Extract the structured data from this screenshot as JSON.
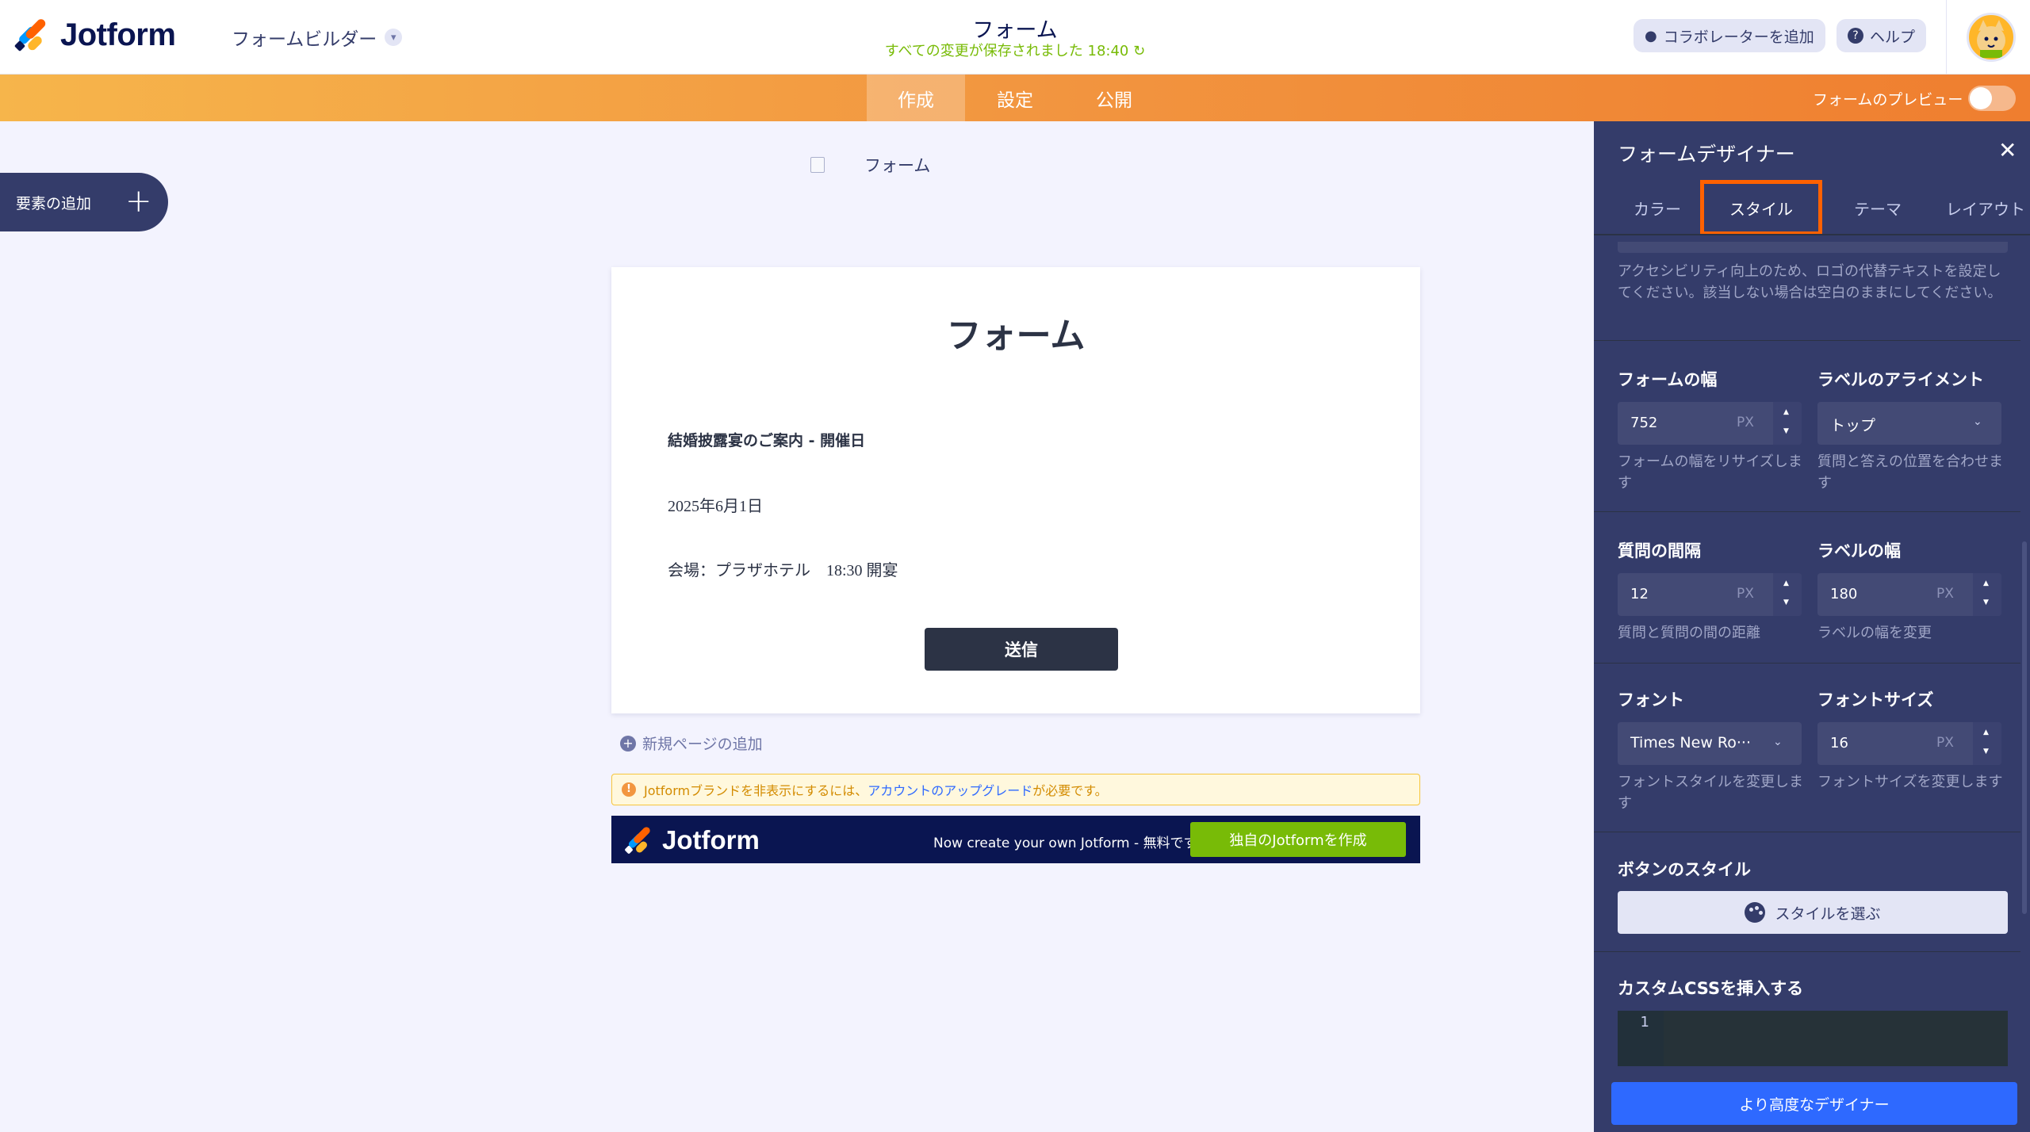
{
  "header": {
    "logo_text": "Jotform",
    "builder_label": "フォームビルダー",
    "form_title": "フォーム",
    "save_status": "すべての変更が保存されました 18:40",
    "collaborator_label": "コラボレーターを追加",
    "help_label": "ヘルプ"
  },
  "nav": {
    "tabs": [
      {
        "label": "作成",
        "active": true
      },
      {
        "label": "設定",
        "active": false
      },
      {
        "label": "公開",
        "active": false
      }
    ],
    "preview_label": "フォームのプレビュー",
    "preview_on": false,
    "accent_color": "#f29640"
  },
  "sidebar": {
    "add_element_label": "要素の追加"
  },
  "canvas": {
    "logo_alt": "フォーム",
    "form": {
      "heading": "フォーム",
      "line1": "結婚披露宴のご案内 - 開催日",
      "line2": "2025年6月1日",
      "line3": "会場：プラザホテル　18:30 開宴",
      "submit_label": "送信"
    },
    "add_page_label": "新規ページの追加",
    "brand_warning": {
      "text_before": "Jotformブランドを非表示にするには、",
      "link": "アカウントのアップグレード",
      "text_after": "が必要です。"
    },
    "banner": {
      "logo_text": "Jotform",
      "cta_text": "Now create your own Jotform - 無料です",
      "cta_button": "独自のJotformを作成"
    }
  },
  "designer": {
    "title": "フォームデザイナー",
    "tabs": [
      {
        "label": "カラー",
        "active": false
      },
      {
        "label": "スタイル",
        "active": true
      },
      {
        "label": "テーマ",
        "active": false
      },
      {
        "label": "レイアウト",
        "active": false
      }
    ],
    "alt_help": "アクセシビリティ向上のため、ロゴの代替テキストを設定してください。該当しない場合は空白のままにしてください。",
    "form_width": {
      "label": "フォームの幅",
      "value": "752",
      "unit": "PX",
      "help": "フォームの幅をリサイズします"
    },
    "label_alignment": {
      "label": "ラベルのアライメント",
      "value": "トップ",
      "help": "質問と答えの位置を合わせます"
    },
    "question_spacing": {
      "label": "質問の間隔",
      "value": "12",
      "unit": "PX",
      "help": "質問と質問の間の距離"
    },
    "label_width": {
      "label": "ラベルの幅",
      "value": "180",
      "unit": "PX",
      "help": "ラベルの幅を変更"
    },
    "font": {
      "label": "フォント",
      "value": "Times New Ro···",
      "help": "フォントスタイルを変更します"
    },
    "font_size": {
      "label": "フォントサイズ",
      "value": "16",
      "unit": "PX",
      "help": "フォントサイズを変更します"
    },
    "button_style": {
      "label": "ボタンのスタイル",
      "button": "スタイルを選ぶ"
    },
    "custom_css": {
      "label": "カスタムCSSを挿入する",
      "line_number": "1"
    },
    "advanced_button": "より高度なデザイナー"
  }
}
